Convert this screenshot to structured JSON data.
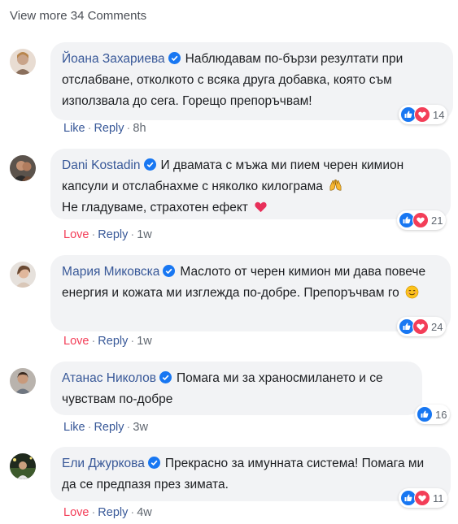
{
  "view_more": "View more 34 Comments",
  "comments": [
    {
      "author": "Йоана Захариева",
      "text": "Наблюдавам по-бързи резултати при отслабване, отколкото с всяка друга добавка, която съм използвала до сега. Горещо препоръчвам!",
      "reaction_count": "14",
      "reactions": [
        "like-icon",
        "love-icon"
      ],
      "action_primary": "Like",
      "reply": "Reply",
      "time": "8h"
    },
    {
      "author": "Dani Kostadin",
      "text": "И двамата с мъжа ми пием черен кимион капсули и отслабнахме с няколко килограма",
      "emoji1": "raising-hands-emoji",
      "text2": "Не гладуваме, страхотен ефект",
      "emoji2": "heart-emoji",
      "reaction_count": "21",
      "reactions": [
        "like-icon",
        "love-icon"
      ],
      "action_primary": "Love",
      "reply": "Reply",
      "time": "1w"
    },
    {
      "author": "Мария Миковска",
      "text": "Маслото от черен кимион ми дава повече енергия и кожата ми изглежда по-добре. Препоръчвам го",
      "emoji1": "smiling-face-emoji",
      "reaction_count": "24",
      "reactions": [
        "like-icon",
        "love-icon"
      ],
      "action_primary": "Love",
      "reply": "Reply",
      "time": "1w"
    },
    {
      "author": "Атанас Николов",
      "text": "Помага ми за храносмилането и се чувствам по-добре",
      "reaction_count": "16",
      "reactions": [
        "like-icon"
      ],
      "action_primary": "Like",
      "reply": "Reply",
      "time": "3w"
    },
    {
      "author": "Ели Джуркова",
      "text": "Прекрасно за имунната система! Помага ми да се предпазя през зимата.",
      "reaction_count": "11",
      "reactions": [
        "like-icon",
        "love-icon"
      ],
      "action_primary": "Love",
      "reply": "Reply",
      "time": "4w"
    }
  ],
  "colors": {
    "name": "#385898",
    "bubble": "#f2f3f5",
    "like": "#1877f2",
    "love": "#f33e58",
    "meta": "#606770"
  }
}
